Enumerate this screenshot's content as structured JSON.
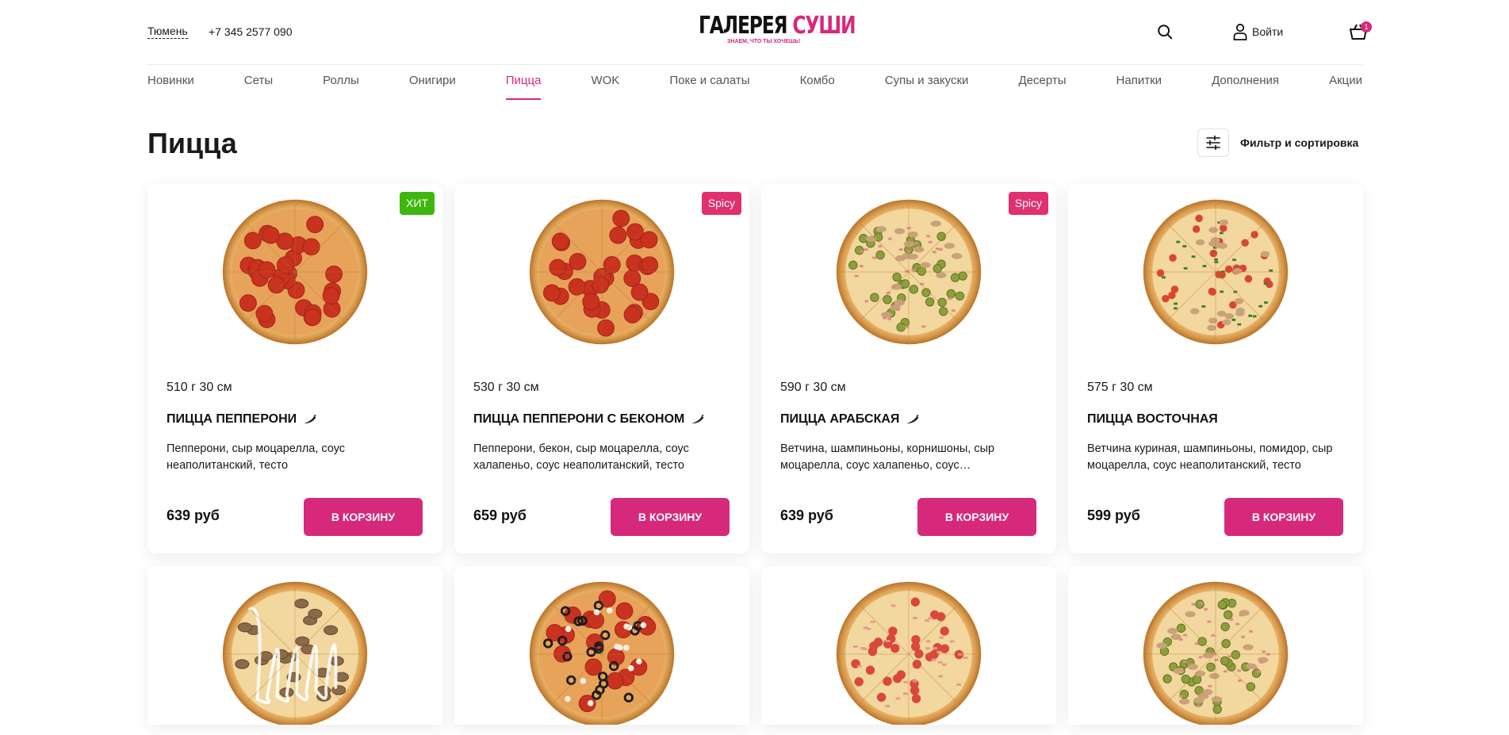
{
  "header": {
    "city": "Тюмень",
    "phone": "+7 345 2577 090",
    "logo_part1": "ГАЛЕРЕЯ",
    "logo_part2": "СУШИ",
    "logo_tagline": "ЗНАЕМ, ЧТО ТЫ ХОЧЕШЬ!",
    "login_label": "Войти",
    "cart_count": "1"
  },
  "categories": [
    "Новинки",
    "Сеты",
    "Роллы",
    "Онигири",
    "Пицца",
    "WOK",
    "Поке и салаты",
    "Комбо",
    "Супы и закуски",
    "Десерты",
    "Напитки",
    "Дополнения",
    "Акции"
  ],
  "active_category": "Пицца",
  "page": {
    "title": "Пицца",
    "filter_label": "Фильтр и сортировка"
  },
  "products": [
    {
      "weight": "510 г 30 см",
      "name": "ПИЦЦА ПЕППЕРОНИ",
      "spicy": true,
      "desc": "Пепперони, сыр моцарелла, соус неаполитанский, тесто",
      "price": "639 руб",
      "button": "В КОРЗИНУ",
      "badge": "ХИТ",
      "badge_color": "#3db70f",
      "topping": "pepperoni"
    },
    {
      "weight": "530 г 30 см",
      "name": "ПИЦЦА ПЕППЕРОНИ С БЕКОНОМ",
      "spicy": true,
      "desc": "Пепперони, бекон, сыр моцарелла, соус халапеньо, соус неаполитанский, тесто",
      "price": "659 руб",
      "button": "В КОРЗИНУ",
      "badge": "Spicy",
      "badge_color": "#e0306f",
      "topping": "pepperoni"
    },
    {
      "weight": "590 г 30 см",
      "name": "ПИЦЦА АРАБСКАЯ",
      "spicy": true,
      "desc": "Ветчина, шампиньоны, корнишоны, сыр моцарелла, соус халапеньо, соус…",
      "price": "639 руб",
      "button": "В КОРЗИНУ",
      "badge": "Spicy",
      "badge_color": "#e0306f",
      "topping": "pickles"
    },
    {
      "weight": "575 г 30 см",
      "name": "ПИЦЦА ВОСТОЧНАЯ",
      "spicy": false,
      "desc": "Ветчина куриная, шампиньоны, помидор, сыр моцарелла, соус неаполитанский, тесто",
      "price": "599 руб",
      "button": "В КОРЗИНУ",
      "badge": "",
      "badge_color": "",
      "topping": "mixed"
    },
    {
      "topping": "mushroom"
    },
    {
      "topping": "olives"
    },
    {
      "topping": "ham"
    },
    {
      "topping": "pickles"
    }
  ]
}
